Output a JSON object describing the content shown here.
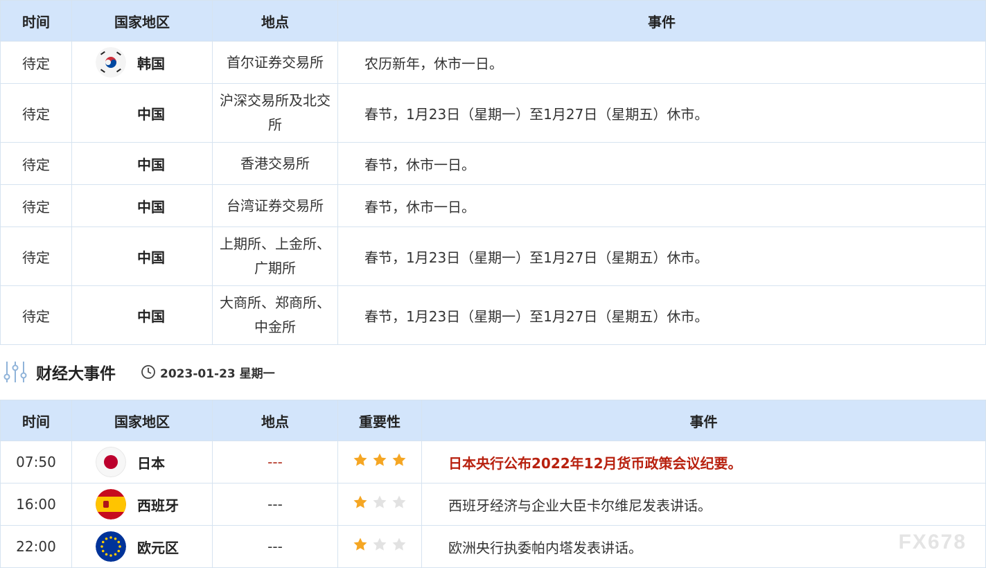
{
  "holiday_table": {
    "headers": {
      "time": "时间",
      "country": "国家地区",
      "place": "地点",
      "event": "事件"
    },
    "rows": [
      {
        "time": "待定",
        "country": "韩国",
        "flag": "south-korea",
        "place": "首尔证券交易所",
        "event": "农历新年，休市一日。"
      },
      {
        "time": "待定",
        "country": "中国",
        "flag": "none",
        "place": "沪深交易所及北交所",
        "event": "春节，1月23日（星期一）至1月27日（星期五）休市。"
      },
      {
        "time": "待定",
        "country": "中国",
        "flag": "none",
        "place": "香港交易所",
        "event": "春节，休市一日。"
      },
      {
        "time": "待定",
        "country": "中国",
        "flag": "none",
        "place": "台湾证券交易所",
        "event": "春节，休市一日。"
      },
      {
        "time": "待定",
        "country": "中国",
        "flag": "none",
        "place": "上期所、上金所、广期所",
        "event": "春节，1月23日（星期一）至1月27日（星期五）休市。"
      },
      {
        "time": "待定",
        "country": "中国",
        "flag": "none",
        "place": "大商所、郑商所、中金所",
        "event": "春节，1月23日（星期一）至1月27日（星期五）休市。"
      }
    ]
  },
  "section": {
    "title": "财经大事件",
    "date": "2023-01-23 星期一",
    "icon": "sliders-icon"
  },
  "events_table": {
    "headers": {
      "time": "时间",
      "country": "国家地区",
      "place": "地点",
      "importance": "重要性",
      "event": "事件"
    },
    "rows": [
      {
        "time": "07:50",
        "country": "日本",
        "flag": "japan",
        "place": "---",
        "importance": 3,
        "event": "日本央行公布2022年12月货币政策会议纪要。",
        "highlight": true
      },
      {
        "time": "16:00",
        "country": "西班牙",
        "flag": "spain",
        "place": "---",
        "importance": 1,
        "event": "西班牙经济与企业大臣卡尔维尼发表讲话。",
        "highlight": false
      },
      {
        "time": "22:00",
        "country": "欧元区",
        "flag": "eu",
        "place": "---",
        "importance": 1,
        "event": "欧洲央行执委帕内塔发表讲话。",
        "highlight": false
      }
    ]
  },
  "watermark": "FX678",
  "colors": {
    "header_bg": "#d3e5fb",
    "border": "#d6e3f0",
    "highlight_text": "#b8210f",
    "star_on": "#f5a623",
    "star_off": "#e2e2e2"
  }
}
